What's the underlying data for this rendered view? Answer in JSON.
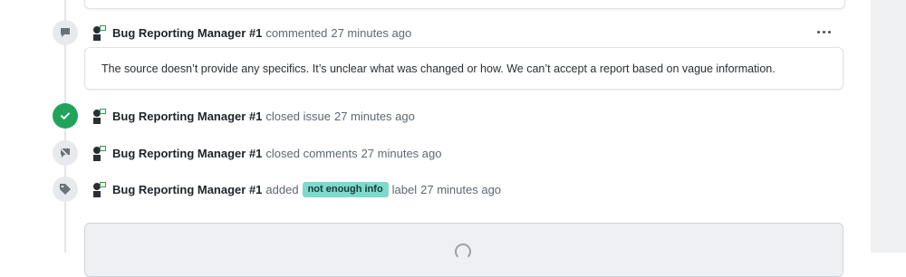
{
  "comment_event": {
    "actor": "Bug Reporting Manager #1",
    "action": "commented",
    "time": "27 minutes ago",
    "body": "The source doesn’t provide any specifics. It’s unclear what was changed or how. We can’t accept a report based on vague information."
  },
  "events": [
    {
      "icon": "check-circle-icon",
      "actor": "Bug Reporting Manager #1",
      "action": "closed issue",
      "time": "27 minutes ago"
    },
    {
      "icon": "comment-locked-icon",
      "actor": "Bug Reporting Manager #1",
      "action": "closed comments",
      "time": "27 minutes ago"
    },
    {
      "icon": "tag-icon",
      "actor": "Bug Reporting Manager #1",
      "action_before": "added",
      "label": "not enough info",
      "action_after": "label",
      "time": "27 minutes ago"
    }
  ],
  "colors": {
    "success": "#21a35b",
    "label_bg": "#7fd8cc",
    "timeline_icon_bg": "#e7e9ec"
  }
}
